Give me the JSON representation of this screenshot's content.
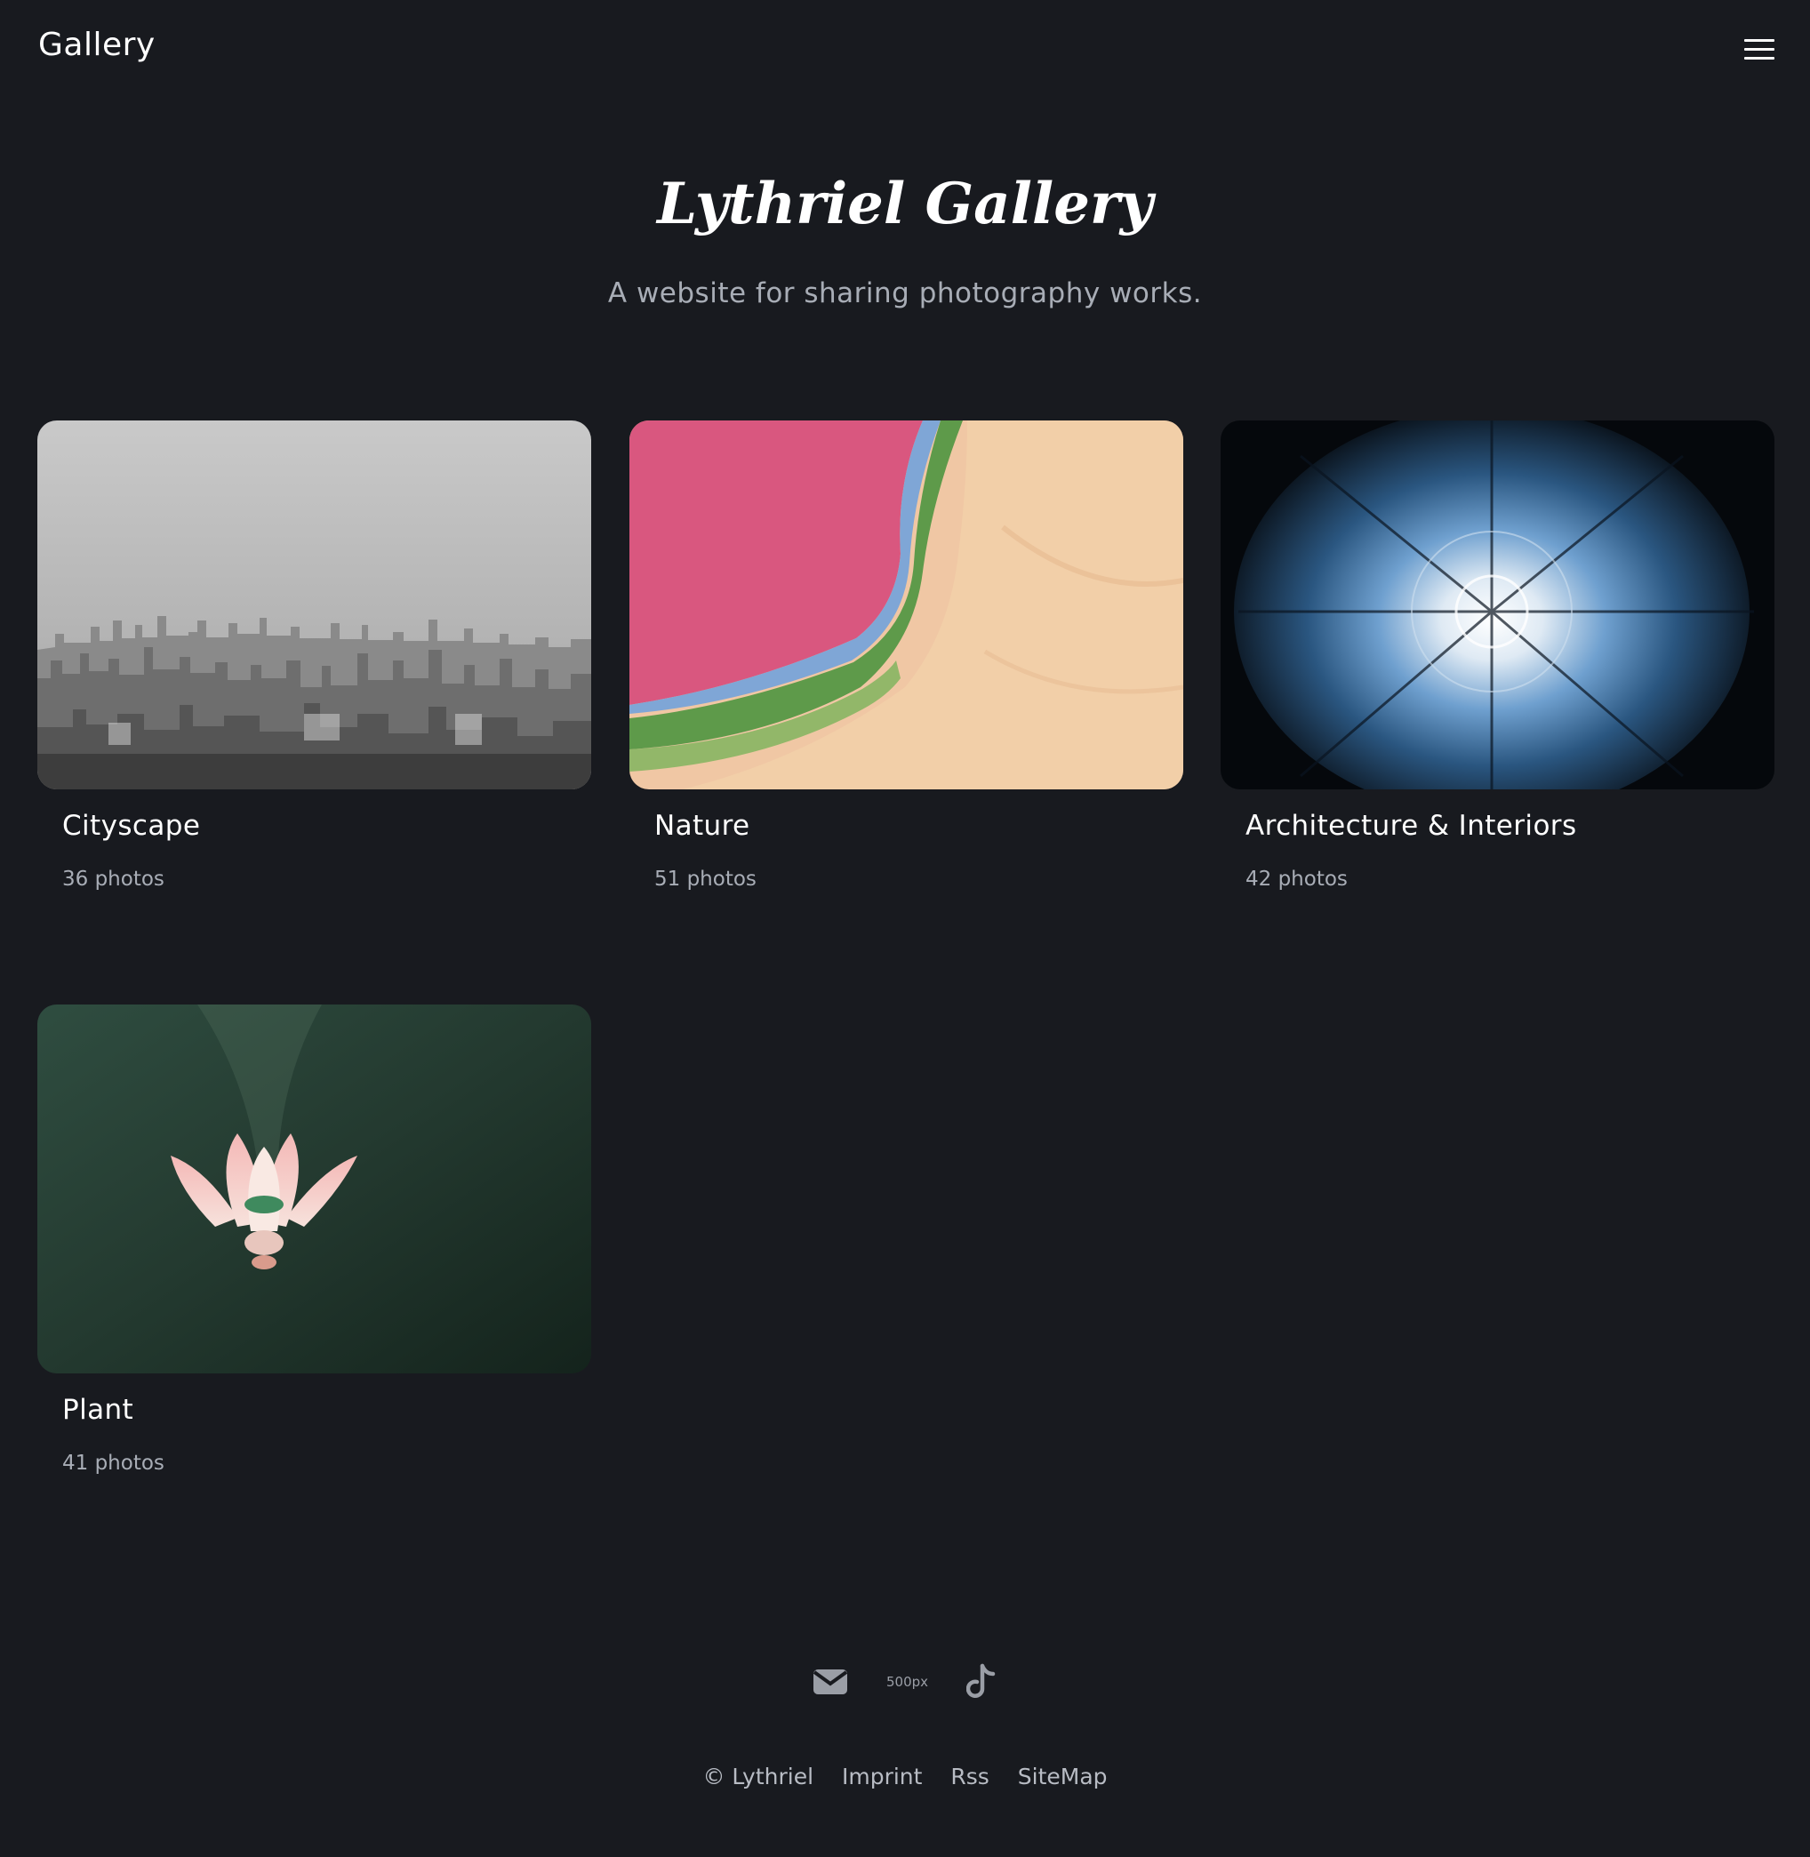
{
  "header": {
    "brand": "Gallery",
    "menu_icon": "hamburger-menu-icon"
  },
  "hero": {
    "title": "Lythriel Gallery",
    "subtitle": "A website for sharing photography works."
  },
  "albums": [
    {
      "title": "Cityscape",
      "count": "36 photos"
    },
    {
      "title": "Nature",
      "count": "51 photos"
    },
    {
      "title": "Architecture & Interiors",
      "count": "42 photos"
    },
    {
      "title": "Plant",
      "count": "41 photos"
    }
  ],
  "social": {
    "icons": [
      "mail-icon",
      "500px-icon",
      "tiktok-icon"
    ],
    "px500_label": "500px"
  },
  "footer": {
    "copyright": "© Lythriel",
    "links": [
      "Imprint",
      "Rss",
      "SiteMap"
    ]
  },
  "colors": {
    "background": "#181a1f",
    "text_primary": "#ffffff",
    "text_muted": "#a8adb6",
    "icon_gray": "#9a9ea6"
  }
}
